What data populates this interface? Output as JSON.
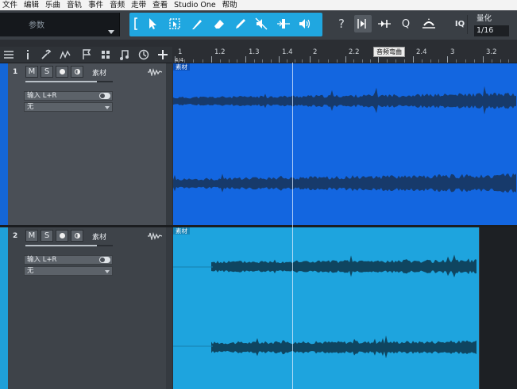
{
  "menu": [
    "文件",
    "编辑",
    "乐曲",
    "音轨",
    "事件",
    "音频",
    "走带",
    "查看",
    "Studio One",
    "帮助"
  ],
  "toolbar": {
    "param_label": "参数",
    "quantize_label": "量化",
    "quantize_value": "1/16",
    "iq_label": "IQ",
    "help_label": "?",
    "q_label": "Q"
  },
  "ruler": {
    "ticks": [
      "1",
      "1.2",
      "1.3",
      "1.4",
      "2",
      "2.2",
      "2.3",
      "2.4",
      "3",
      "3.2"
    ],
    "time_signature": "4/4",
    "tooltip": "音频弯曲"
  },
  "tracks": [
    {
      "number": "1",
      "name": "素材",
      "mute": "M",
      "solo": "S",
      "input": "输入 L+R",
      "output": "无",
      "clip_name": "素材",
      "volume": 0.82
    },
    {
      "number": "2",
      "name": "素材",
      "mute": "M",
      "solo": "S",
      "input": "输入 L+R",
      "output": "无",
      "clip_name": "素材",
      "volume": 0.82
    }
  ],
  "colors": {
    "track1_strip": "#1466d6",
    "track2_strip": "#1fa0d8",
    "clip1": "#1366e0",
    "clip2": "#1ea4de",
    "wave1": "#173a6b",
    "wave2": "#0f4560",
    "toolgroup": "#20a7e0",
    "toolbar_bg": "#3a3f45"
  }
}
